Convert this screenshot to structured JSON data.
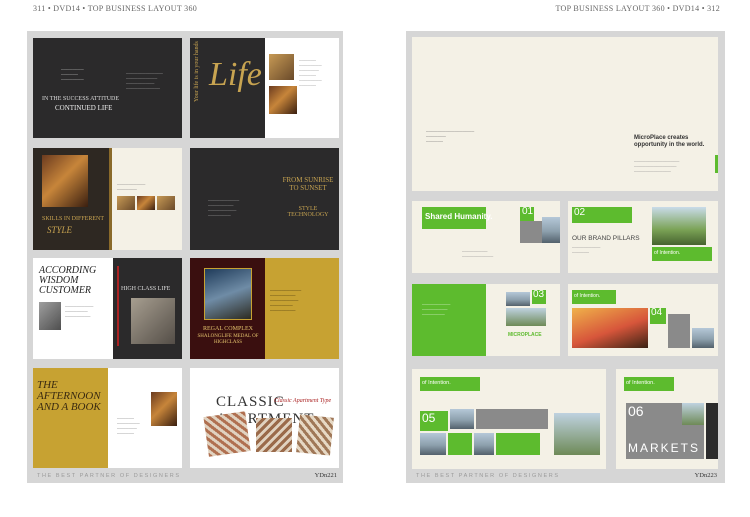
{
  "header": {
    "left": "311 • DVD14 • TOP BUSINESS LAYOUT 360",
    "right": "TOP BUSINESS LAYOUT 360 • DVD14 • 312"
  },
  "footer": {
    "left_tagline": "THE BEST PARTNER OF DESIGNERS",
    "left_number": "YDn221",
    "right_tagline": "THE BEST PARTNER OF DESIGNERS",
    "right_number": "YDn223"
  },
  "left_page": {
    "t1": {
      "heading": "IN THE SUCCESS ATTITUDE",
      "sub": "CONTINUED LIFE"
    },
    "t2": {
      "script": "Life",
      "side": "Your life is in your hands"
    },
    "t3": {
      "heading": "SKILLS IN DIFFERENT",
      "sub": "STYLE"
    },
    "t4": {
      "heading": "FROM SUNRISE TO SUNSET",
      "sub": "STYLE TECHNOLOGY"
    },
    "t5": {
      "heading": "ACCORDING WISDOM CUSTOMER",
      "side": "HIGH CLASS LIFE"
    },
    "t6": {
      "heading": "REGAL COMPLEX",
      "sub": "SHALONGLIFE MEDAL OF HIGHCLASS"
    },
    "t7": {
      "heading": "THE AFTERNOON AND A BOOK"
    },
    "t8": {
      "heading": "CLASSIC APARTMENT",
      "sub": "Classic Apartment Type"
    }
  },
  "right_page": {
    "t1": {
      "title": "MicroPlace creates opportunity in the world."
    },
    "t2": {
      "title": "Shared Humanity.",
      "num": "01"
    },
    "t3": {
      "num": "02",
      "title": "OUR BRAND PILLARS",
      "tag": "of Intention."
    },
    "t4": {
      "num": "03",
      "label": "MICROPLACE"
    },
    "t5": {
      "num": "04",
      "tag": "of Intention."
    },
    "t6": {
      "num": "05",
      "tag": "of Intention."
    },
    "t7": {
      "num": "06",
      "tag": "of Intention.",
      "title": "MARKETS"
    }
  }
}
